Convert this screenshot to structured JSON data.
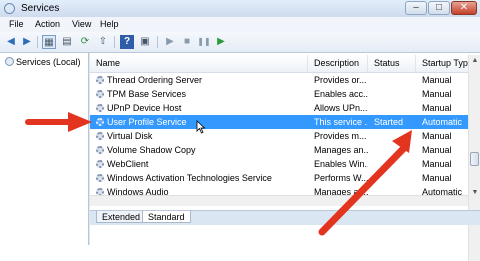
{
  "window": {
    "title": "Services"
  },
  "controls": {
    "minimize": "–",
    "maximize": "□",
    "close": "✕"
  },
  "menu": [
    "File",
    "Action",
    "View",
    "Help"
  ],
  "toolbar": {
    "icons": [
      "back-arrow-icon",
      "forward-arrow-icon",
      "show-hide-tree-icon",
      "properties-icon",
      "refresh-icon",
      "export-list-icon",
      "help-icon",
      "console-icon",
      "start-service-icon",
      "stop-service-icon",
      "pause-service-icon",
      "restart-service-icon"
    ],
    "glyphs": {
      "back": "◀",
      "forward": "▶",
      "tree": "▦",
      "props": "▤",
      "refresh": "⟳",
      "export": "⇧",
      "help": "?",
      "console": "▣",
      "start": "▶",
      "stop": "■",
      "pause": "❚❚",
      "restart": "▶"
    }
  },
  "tree": {
    "root": "Services (Local)"
  },
  "columns": {
    "name": "Name",
    "description": "Description",
    "status": "Status",
    "startup": "Startup Typ"
  },
  "services": [
    {
      "name": "Thread Ordering Server",
      "description": "Provides or...",
      "status": "",
      "startup": "Manual"
    },
    {
      "name": "TPM Base Services",
      "description": "Enables acc...",
      "status": "",
      "startup": "Manual"
    },
    {
      "name": "UPnP Device Host",
      "description": "Allows UPn...",
      "status": "",
      "startup": "Manual"
    },
    {
      "name": "User Profile Service",
      "description": "This service ...",
      "status": "Started",
      "startup": "Automatic",
      "selected": true
    },
    {
      "name": "Virtual Disk",
      "description": "Provides m...",
      "status": "",
      "startup": "Manual"
    },
    {
      "name": "Volume Shadow Copy",
      "description": "Manages an...",
      "status": "",
      "startup": "Manual"
    },
    {
      "name": "WebClient",
      "description": "Enables Win...",
      "status": "",
      "startup": "Manual"
    },
    {
      "name": "Windows Activation Technologies Service",
      "description": "Performs W...",
      "status": "",
      "startup": "Manual"
    },
    {
      "name": "Windows Audio",
      "description": "Manages au...",
      "status": "",
      "startup": "Automatic"
    }
  ],
  "tabs": [
    "Extended",
    "Standard"
  ],
  "annotations": {
    "arrow_color": "#e3341f"
  }
}
